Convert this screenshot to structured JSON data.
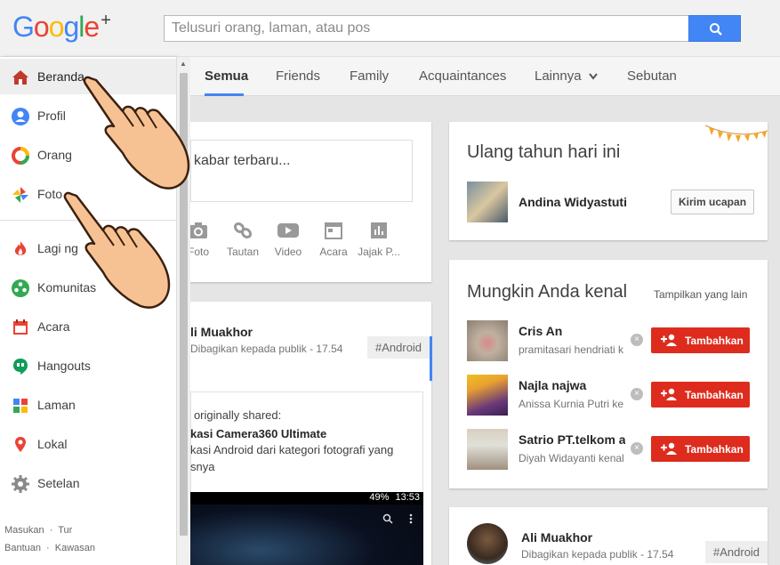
{
  "header": {
    "logo": {
      "g1": "G",
      "g2": "o",
      "g3": "o",
      "g4": "g",
      "g5": "l",
      "g6": "e",
      "plus": "+"
    },
    "search_placeholder": "Telusuri orang, laman, atau pos"
  },
  "tabs": [
    {
      "label": "Semua",
      "active": true
    },
    {
      "label": "Friends"
    },
    {
      "label": "Family"
    },
    {
      "label": "Acquaintances"
    },
    {
      "label": "Lainnya"
    },
    {
      "label": "Sebutan"
    }
  ],
  "nav": [
    {
      "label": "Beranda",
      "icon": "home-icon",
      "active": true
    },
    {
      "label": "Profil",
      "icon": "profile-icon"
    },
    {
      "label": "Orang",
      "icon": "people-icon"
    },
    {
      "label": "Foto",
      "icon": "photos-icon"
    },
    {
      "label": "Lagi ng",
      "icon": "flame-icon"
    },
    {
      "label": "Komunitas",
      "icon": "communities-icon"
    },
    {
      "label": "Acara",
      "icon": "events-icon"
    },
    {
      "label": "Hangouts",
      "icon": "hangouts-icon"
    },
    {
      "label": "Laman",
      "icon": "pages-icon"
    },
    {
      "label": "Lokal",
      "icon": "local-icon"
    },
    {
      "label": "Setelan",
      "icon": "settings-icon"
    }
  ],
  "footer": {
    "line1": [
      "Masukan",
      "Tur"
    ],
    "line2": [
      "Bantuan",
      "Kawasan"
    ],
    "sep": "·"
  },
  "share": {
    "prompt": "kabar terbaru...",
    "actions": [
      "Foto",
      "Tautan",
      "Video",
      "Acara",
      "Jajak P..."
    ]
  },
  "post1": {
    "author": "li Muakhor",
    "meta": "Dibagikan kepada publik  -  17.54",
    "hashtag": "#Android",
    "reshare_label": "r originally shared:",
    "reshare_title": "kasi Camera360 Ultimate",
    "reshare_desc": "kasi Android dari kategori fotografi yang",
    "reshare_desc2": "snya",
    "phone_status": "49%",
    "phone_time": "13:53"
  },
  "birthday": {
    "title": "Ulang tahun hari ini",
    "name": "Andina Widyastuti",
    "button": "Kirim ucapan"
  },
  "suggest": {
    "title": "Mungkin Anda kenal",
    "more": "Tampilkan yang lain",
    "people": [
      {
        "name": "Cris An",
        "sub": "pramitasari hendriati k"
      },
      {
        "name": "Najla najwa",
        "sub": "Anissa Kurnia Putri ke"
      },
      {
        "name": "Satrio PT.telkom al",
        "sub": "Diyah Widayanti kenal"
      }
    ],
    "add_label": "Tambahkan",
    "dismiss": "×"
  },
  "post2": {
    "author": "Ali Muakhor",
    "meta": "Dibagikan kepada publik  -  17.54",
    "hashtag": "#Android"
  },
  "colors": {
    "accent": "#4285f4",
    "red": "#dd2c1e"
  }
}
